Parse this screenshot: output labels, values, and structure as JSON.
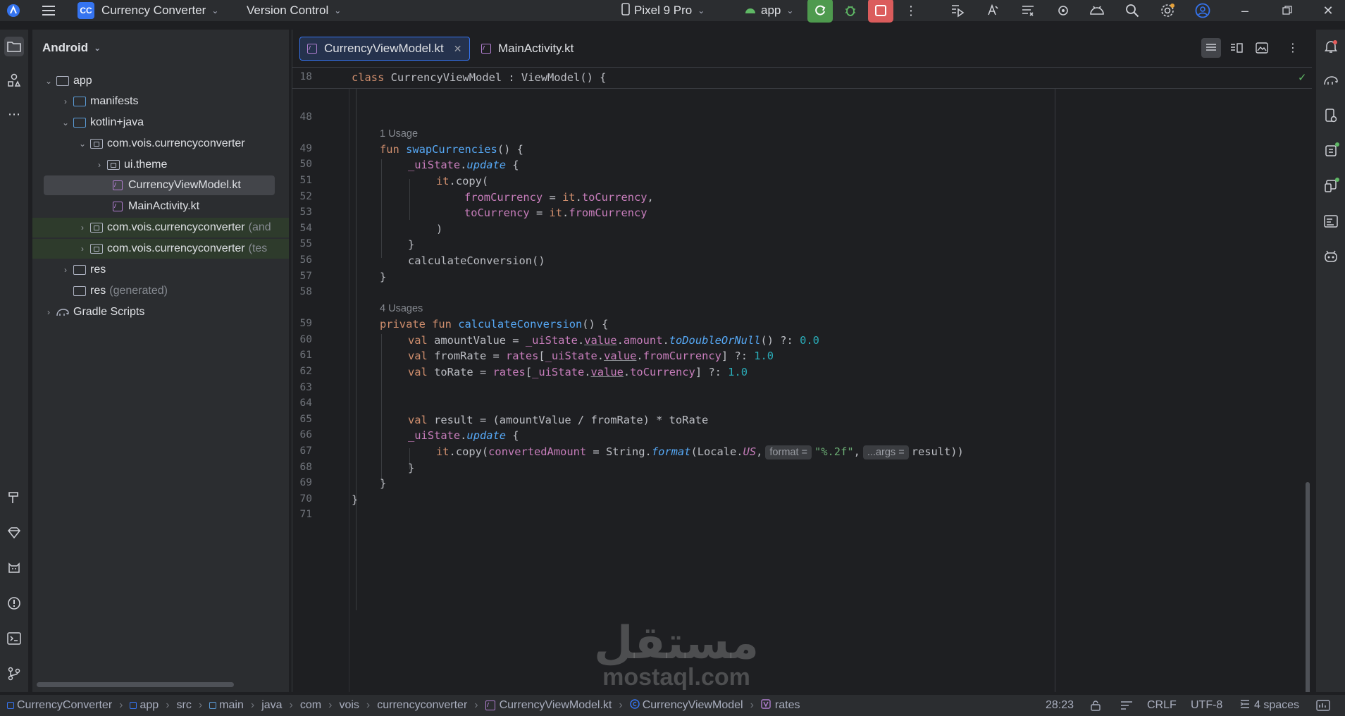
{
  "titlebar": {
    "project_badge": "CC",
    "project_name": "Currency Converter",
    "vcs": "Version Control",
    "device": "Pixel 9 Pro",
    "run_config": "app"
  },
  "project_panel": {
    "view_mode": "Android",
    "tree": [
      {
        "label": "app",
        "suffix": ""
      },
      {
        "label": "manifests",
        "suffix": ""
      },
      {
        "label": "kotlin+java",
        "suffix": ""
      },
      {
        "label": "com.vois.currencyconverter",
        "suffix": ""
      },
      {
        "label": "ui.theme",
        "suffix": ""
      },
      {
        "label": "CurrencyViewModel.kt",
        "suffix": ""
      },
      {
        "label": "MainActivity.kt",
        "suffix": ""
      },
      {
        "label": "com.vois.currencyconverter",
        "suffix": "(and"
      },
      {
        "label": "com.vois.currencyconverter",
        "suffix": "(tes"
      },
      {
        "label": "res",
        "suffix": ""
      },
      {
        "label": "res",
        "suffix": "(generated)"
      },
      {
        "label": "Gradle Scripts",
        "suffix": ""
      }
    ]
  },
  "editor": {
    "tabs": [
      {
        "label": "CurrencyViewModel.kt",
        "active": true
      },
      {
        "label": "MainActivity.kt",
        "active": false
      }
    ],
    "sticky_line": {
      "number": "18",
      "text": "class CurrencyViewModel : ViewModel() {"
    },
    "usages": [
      "1 Usage",
      "4 Usages"
    ],
    "line_numbers": [
      "48",
      "49",
      "50",
      "51",
      "52",
      "53",
      "54",
      "55",
      "56",
      "57",
      "58",
      "59",
      "60",
      "61",
      "62",
      "63",
      "64",
      "65",
      "66",
      "67",
      "68",
      "69",
      "70",
      "71"
    ],
    "hints": {
      "format": "format =",
      "args": "...args ="
    }
  },
  "statusbar": {
    "breadcrumbs": [
      "CurrencyConverter",
      "app",
      "src",
      "main",
      "java",
      "com",
      "vois",
      "currencyconverter",
      "CurrencyViewModel.kt",
      "CurrencyViewModel",
      "rates"
    ],
    "position": "28:23",
    "line_ending": "CRLF",
    "encoding": "UTF-8",
    "indent": "4 spaces"
  },
  "watermark": {
    "arabic": "مستقل",
    "latin": "mostaql.com"
  },
  "colors": {
    "accent": "#3574f0",
    "run": "#4e9a4e",
    "stop": "#db5c5c",
    "keyword": "#cf8e6d",
    "function": "#56a8f5",
    "field": "#c77dbb",
    "number": "#2aacb8",
    "string": "#6aab73"
  }
}
